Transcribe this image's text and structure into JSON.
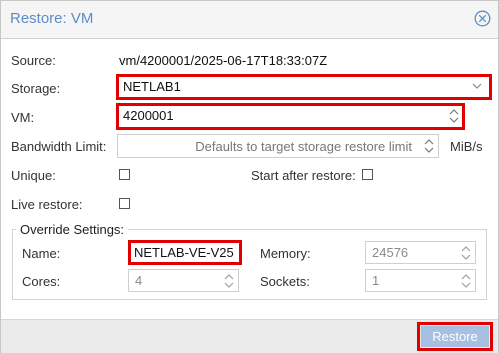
{
  "dialog": {
    "title": "Restore: VM",
    "close_icon": "close-circle-icon"
  },
  "form": {
    "source_label": "Source:",
    "source_value": "vm/4200001/2025-06-17T18:33:07Z",
    "storage_label": "Storage:",
    "storage_value": "NETLAB1",
    "vm_label": "VM:",
    "vm_value": "4200001",
    "bandwidth_label": "Bandwidth Limit:",
    "bandwidth_placeholder": "Defaults to target storage restore limit",
    "bandwidth_unit": "MiB/s",
    "unique_label": "Unique:",
    "unique_checked": false,
    "start_after_label": "Start after restore:",
    "start_after_checked": false,
    "live_restore_label": "Live restore:",
    "live_restore_checked": false
  },
  "override": {
    "legend": "Override Settings:",
    "name_label": "Name:",
    "name_value": "NETLAB-VE-V25",
    "memory_label": "Memory:",
    "memory_value": "24576",
    "cores_label": "Cores:",
    "cores_value": "4",
    "sockets_label": "Sockets:",
    "sockets_value": "1"
  },
  "footer": {
    "restore_label": "Restore"
  },
  "colors": {
    "title": "#5b8dc7",
    "highlight": "#e00000",
    "restore_button": "#a7bfe0"
  }
}
